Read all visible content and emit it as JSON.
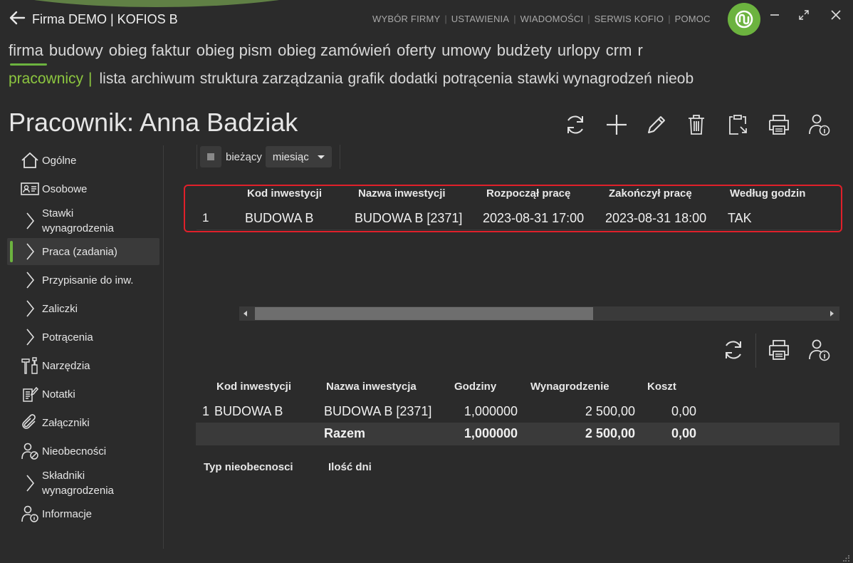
{
  "app": {
    "title": "Firma DEMO | KOFIOS B",
    "top_links": [
      "WYBÓR FIRMY",
      "USTAWIENIA",
      "WIADOMOŚCI",
      "SERWIS KOFIO",
      "POMOC"
    ],
    "accent": "#6cb33f"
  },
  "nav_modules": [
    "firma",
    "budowy",
    "obieg faktur",
    "obieg pism",
    "obieg zamówień",
    "oferty",
    "umowy",
    "budżety",
    "urlopy",
    "crm",
    "r"
  ],
  "nav_sub": {
    "active": "pracownicy",
    "separator": "|",
    "items": [
      "lista",
      "archiwum",
      "struktura zarządzania",
      "grafik",
      "dodatki",
      "potrącenia",
      "stawki wynagrodzeń",
      "nieob"
    ]
  },
  "page": {
    "title": "Pracownik: Anna Badziak"
  },
  "sidebar": {
    "items": [
      {
        "label": "Ogólne",
        "icon": "home-icon"
      },
      {
        "label": "Osobowe",
        "icon": "id-card-icon"
      },
      {
        "label": "Stawki\nwynagrodzenia",
        "icon": "chevron-right-icon"
      },
      {
        "label": "Praca (zadania)",
        "icon": "chevron-right-icon"
      },
      {
        "label": "Przypisanie do inw.",
        "icon": "chevron-right-icon"
      },
      {
        "label": "Zaliczki",
        "icon": "chevron-right-icon"
      },
      {
        "label": "Potrącenia",
        "icon": "chevron-right-icon"
      },
      {
        "label": "Narzędzia",
        "icon": "tools-icon"
      },
      {
        "label": "Notatki",
        "icon": "note-icon"
      },
      {
        "label": "Załączniki",
        "icon": "paperclip-icon"
      },
      {
        "label": "Nieobecności",
        "icon": "person-absent-icon"
      },
      {
        "label": "Składniki\nwynagrodzenia",
        "icon": "chevron-right-icon"
      },
      {
        "label": "Informacje",
        "icon": "person-info-icon"
      }
    ],
    "active_index": 3
  },
  "filter": {
    "checkbox_label": "bieżący",
    "select_value": "miesiąc"
  },
  "tasks_table": {
    "columns": [
      "Kod inwestycji",
      "Nazwa inwestycji",
      "Rozpoczął pracę",
      "Zakończył pracę",
      "Według godzin"
    ],
    "rows": [
      {
        "no": "1",
        "kod": "BUDOWA B",
        "nazwa": "BUDOWA B [2371]",
        "start": "2023-08-31 17:00",
        "end": "2023-08-31 18:00",
        "godzin": "TAK"
      }
    ]
  },
  "summary_table": {
    "columns": [
      "Kod inwestycji",
      "Nazwa inwestycja",
      "Godziny",
      "Wynagrodzenie",
      "Koszt"
    ],
    "rows": [
      {
        "no": "1",
        "kod": "BUDOWA B",
        "nazwa": "BUDOWA B [2371]",
        "godziny": "1,000000",
        "wynagrodzenie": "2 500,00",
        "koszt": "0,00"
      }
    ],
    "total": {
      "label": "Razem",
      "godziny": "1,000000",
      "wynagrodzenie": "2 500,00",
      "koszt": "0,00"
    }
  },
  "absence_table": {
    "columns": [
      "Typ nieobecnosci",
      "Ilość dni"
    ]
  }
}
